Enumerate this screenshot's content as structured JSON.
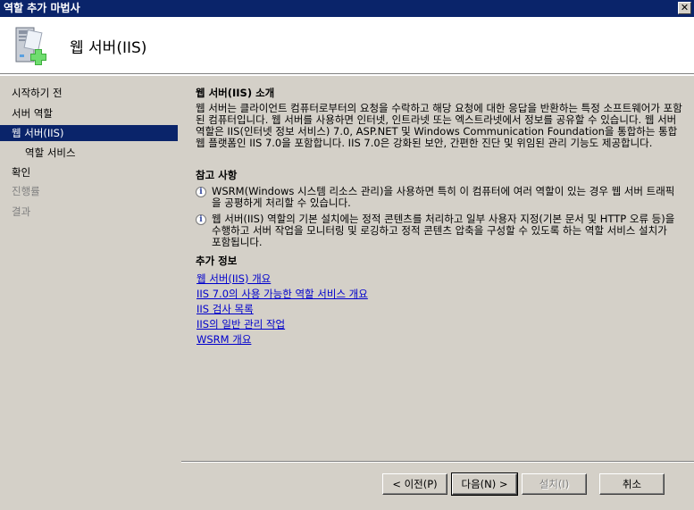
{
  "window": {
    "title": "역할 추가 마법사",
    "close_glyph": "✕"
  },
  "header": {
    "title": "웹 서버(IIS)",
    "icon": "server-add-icon"
  },
  "sidebar": {
    "items": [
      {
        "label": "시작하기 전",
        "state": "normal"
      },
      {
        "label": "서버 역할",
        "state": "normal"
      },
      {
        "label": "웹 서버(IIS)",
        "state": "active"
      },
      {
        "label": "역할 서비스",
        "state": "sub"
      },
      {
        "label": "확인",
        "state": "normal"
      },
      {
        "label": "진행률",
        "state": "disabled"
      },
      {
        "label": "결과",
        "state": "disabled"
      }
    ]
  },
  "main": {
    "intro": {
      "heading": "웹 서버(IIS) 소개",
      "body": "웹 서버는 클라이언트 컴퓨터로부터의 요청을 수락하고 해당 요청에 대한 응답을 반환하는 특정 소프트웨어가 포함된 컴퓨터입니다. 웹 서버를 사용하면 인터넷, 인트라넷 또는 엑스트라넷에서 정보를 공유할 수 있습니다. 웹 서버 역할은 IIS(인터넷 정보 서비스) 7.0, ASP.NET 및 Windows Communication Foundation을 통합하는 통합 웹 플랫폼인 IIS 7.0을 포함합니다. IIS 7.0은 강화된 보안, 간편한 진단 및 위임된 관리 기능도 제공합니다."
    },
    "notes": {
      "heading": "참고 사항",
      "items": [
        "WSRM(Windows 시스템 리소스 관리)을 사용하면 특히 이 컴퓨터에 여러 역할이 있는 경우 웹 서버 트래픽을 공평하게 처리할 수 있습니다.",
        "웹 서버(IIS) 역할의 기본 설치에는 정적 콘텐츠를 처리하고 일부 사용자 지정(기본 문서 및 HTTP 오류 등)을 수행하고 서버 작업을 모니터링 및 로깅하고 정적 콘텐츠 압축을 구성할 수 있도록 하는 역할 서비스 설치가 포함됩니다."
      ]
    },
    "more_info": {
      "heading": "추가 정보",
      "links": [
        "웹 서버(IIS) 개요",
        "IIS 7.0의 사용 가능한 역할 서비스 개요",
        "IIS 검사 목록",
        "IIS의 일반 관리 작업",
        "WSRM 개요"
      ]
    }
  },
  "buttons": {
    "prev": "< 이전(P)",
    "next": "다음(N) >",
    "install": "설치(I)",
    "cancel": "취소"
  }
}
